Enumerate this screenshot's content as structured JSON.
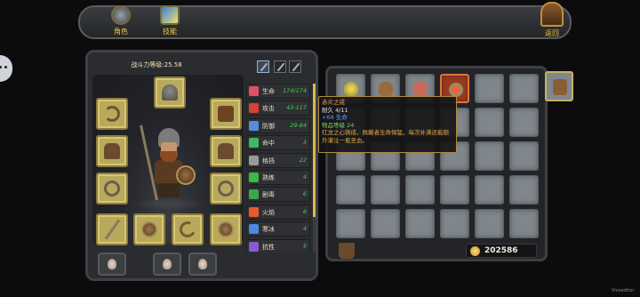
{
  "nav": {
    "tabs": [
      {
        "label": "角色",
        "icon": "helmet-icon"
      },
      {
        "label": "技能",
        "icon": "spellbook-icon"
      }
    ],
    "back_label": "返回"
  },
  "character": {
    "power_label": "战斗力等级:25.58",
    "equipment_slots": [
      {
        "slot": "helmet",
        "icon": "helmet-icon"
      },
      {
        "slot": "whip",
        "icon": "whip-icon"
      },
      {
        "slot": "armor",
        "icon": "armor-icon"
      },
      {
        "slot": "glove-left",
        "icon": "gauntlet-icon"
      },
      {
        "slot": "glove-right",
        "icon": "gauntlet-icon"
      },
      {
        "slot": "ring-left",
        "icon": "ring-icon"
      },
      {
        "slot": "ring-right",
        "icon": "ring-icon"
      },
      {
        "slot": "spear",
        "icon": "spear-icon"
      },
      {
        "slot": "shield",
        "icon": "shield-icon"
      },
      {
        "slot": "crossbow",
        "icon": "crossbow-icon"
      },
      {
        "slot": "round-shield",
        "icon": "round-shield-icon"
      }
    ],
    "potions": [
      "potion-icon",
      "potion-icon",
      "potion-icon"
    ]
  },
  "stats": {
    "rows": [
      {
        "name": "生命",
        "value": "174/174",
        "icon": "heart-icon",
        "color": "#e0506a"
      },
      {
        "name": "攻击",
        "value": "43-117",
        "icon": "sword-icon",
        "color": "#d8403a"
      },
      {
        "name": "防御",
        "value": "29-84",
        "icon": "shield-icon",
        "color": "#5a8ae0"
      },
      {
        "name": "命中",
        "value": "3",
        "icon": "target-icon",
        "color": "#40b860"
      },
      {
        "name": "格挡",
        "value": "22",
        "icon": "block-icon",
        "color": "#9a9a9a"
      },
      {
        "name": "熟练",
        "value": "4",
        "icon": "clover-icon",
        "color": "#3ab84a"
      },
      {
        "name": "剧毒",
        "value": "6",
        "icon": "poison-icon",
        "color": "#3aa84a"
      },
      {
        "name": "火焰",
        "value": "6",
        "icon": "fire-icon",
        "color": "#e85a2a"
      },
      {
        "name": "寒冰",
        "value": "4",
        "icon": "ice-icon",
        "color": "#4a8ae0"
      },
      {
        "name": "抗性",
        "value": "5",
        "icon": "resist-icon",
        "color": "#8a5ad0"
      }
    ]
  },
  "inventory": {
    "items": [
      {
        "index": 0,
        "icon": "yellow-potion-icon"
      },
      {
        "index": 1,
        "icon": "leather-bag-icon"
      },
      {
        "index": 2,
        "icon": "meat-icon"
      },
      {
        "index": 3,
        "icon": "ruby-ring-icon",
        "selected": true
      }
    ],
    "gold": "202586"
  },
  "tooltip": {
    "name": "赤炎之戒",
    "durability": "耐久 4/11",
    "bonus": "+68 生命",
    "item_level": "物品等级 24",
    "description": "红龙之心铸成，佩戴者生命悍猛，每次补满还能额外灌注一瓶圣血。"
  },
  "watermark": "Vivoeditor"
}
